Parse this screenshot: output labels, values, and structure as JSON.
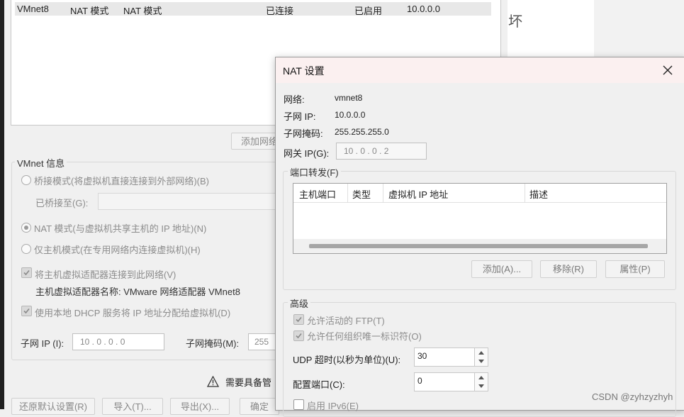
{
  "network_table": {
    "row": [
      "VMnet8",
      "NAT 模式",
      "NAT 模式",
      "已连接",
      "已启用",
      "10.0.0.0"
    ]
  },
  "add_network_button": "添加网络",
  "vmnet_info": {
    "legend": "VMnet 信息",
    "bridged_mode": "桥接模式(将虚拟机直接连接到外部网络)(B)",
    "bridged_to_label": "已桥接至(G):",
    "nat_mode": "NAT 模式(与虚拟机共享主机的 IP 地址)(N)",
    "host_only_mode": "仅主机模式(在专用网络内连接虚拟机)(H)",
    "connect_adapter": "将主机虚拟适配器连接到此网络(V)",
    "adapter_name": "主机虚拟适配器名称: VMware 网络适配器 VMnet8",
    "use_dhcp": "使用本地 DHCP 服务将 IP 地址分配给虚拟机(D)",
    "subnet_ip_label": "子网 IP (I):",
    "subnet_ip_value": "10 . 0 . 0 . 0",
    "subnet_mask_label": "子网掩码(M):",
    "subnet_mask_value": "255"
  },
  "admin_warning": "需要具备管",
  "bottom_buttons": {
    "restore_defaults": "还原默认设置(R)",
    "import": "导入(T)...",
    "export": "导出(X)...",
    "ok": "确定"
  },
  "doc_fragment": "坏",
  "nat_dialog": {
    "title": "NAT 设置",
    "network_label": "网络:",
    "network_value": "vmnet8",
    "subnet_ip_label": "子网 IP:",
    "subnet_ip_value": "10.0.0.0",
    "subnet_mask_label": "子网掩码:",
    "subnet_mask_value": "255.255.255.0",
    "gateway_label": "网关 IP(G):",
    "gateway_value": "10 . 0 . 0 . 2",
    "port_forward": {
      "legend": "端口转发(F)",
      "columns": [
        "主机端口",
        "类型",
        "虚拟机 IP 地址",
        "描述"
      ],
      "add": "添加(A)...",
      "remove": "移除(R)",
      "properties": "属性(P)"
    },
    "advanced": {
      "legend": "高级",
      "allow_ftp": "允许活动的 FTP(T)",
      "allow_oui": "允许任何组织唯一标识符(O)",
      "udp_timeout_label": "UDP 超时(以秒为单位)(U):",
      "udp_timeout_value": "30",
      "config_port_label": "配置端口(C):",
      "config_port_value": "0",
      "enable_ipv6": "启用 IPv6(E)"
    }
  },
  "watermark": "CSDN @zyhzyzhyh"
}
